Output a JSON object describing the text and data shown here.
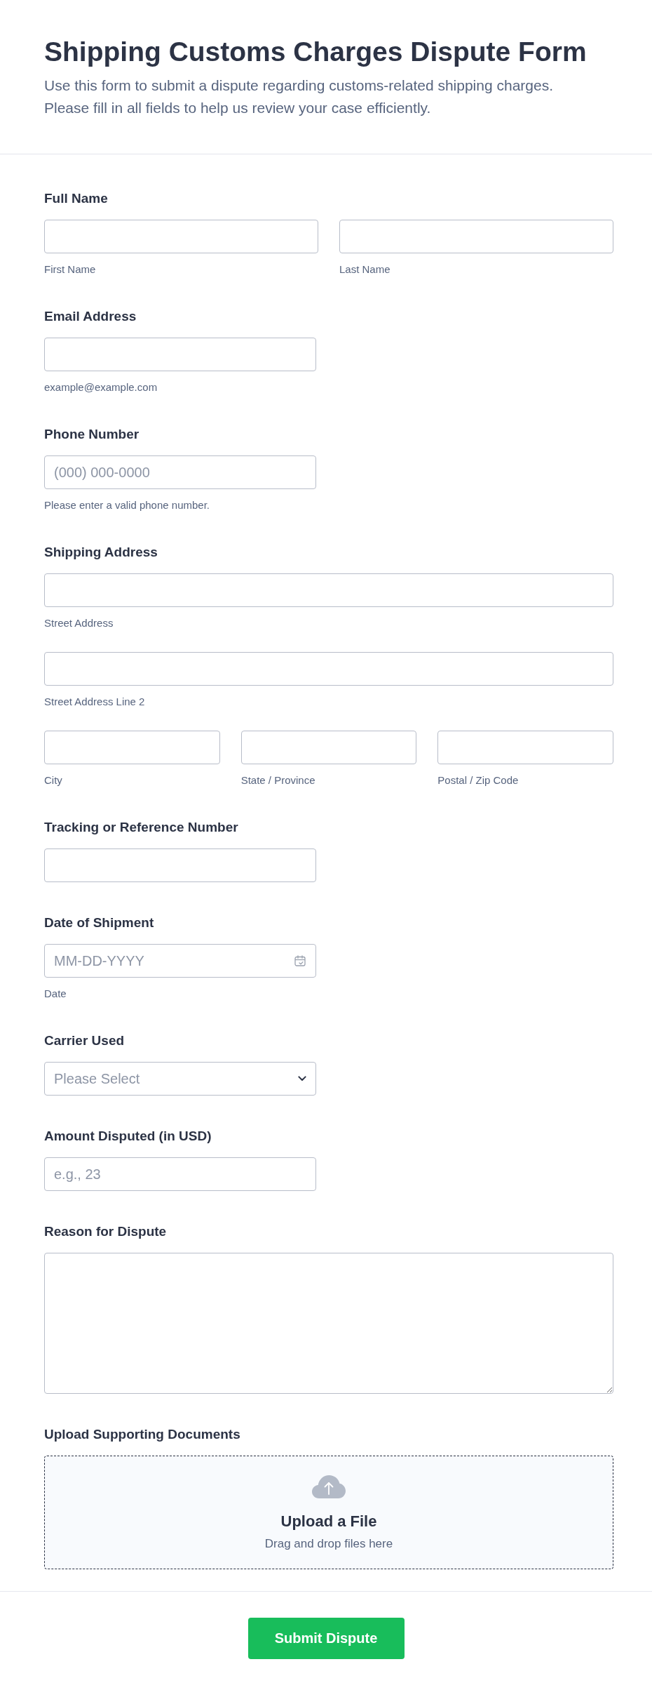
{
  "header": {
    "title": "Shipping Customs Charges Dispute Form",
    "description": [
      "Use this form to submit a dispute regarding customs-related shipping charges.",
      "Please fill in all fields to help us review your case efficiently."
    ]
  },
  "fields": [
    {
      "kind": "multi",
      "label": "Full Name",
      "rows": [
        [
          {
            "sublabel": "First Name"
          },
          {
            "sublabel": "Last Name"
          }
        ]
      ]
    },
    {
      "kind": "text",
      "label": "Email Address",
      "sublabel": "example@example.com"
    },
    {
      "kind": "text",
      "label": "Phone Number",
      "placeholder": "(000) 000-0000",
      "sublabel": "Please enter a valid phone number."
    },
    {
      "kind": "multi",
      "label": "Shipping Address",
      "rows": [
        [
          {
            "sublabel": "Street Address"
          }
        ],
        [
          {
            "sublabel": "Street Address Line 2"
          }
        ],
        [
          {
            "sublabel": "City"
          },
          {
            "sublabel": "State / Province"
          },
          {
            "sublabel": "Postal / Zip Code"
          }
        ]
      ]
    },
    {
      "kind": "text",
      "label": "Tracking or Reference Number"
    },
    {
      "kind": "date",
      "label": "Date of Shipment",
      "placeholder": "MM-DD-YYYY",
      "sublabel": "Date"
    },
    {
      "kind": "select",
      "label": "Carrier Used",
      "placeholder": "Please Select"
    },
    {
      "kind": "text",
      "label": "Amount Disputed (in USD)",
      "placeholder": "e.g., 23"
    },
    {
      "kind": "textarea",
      "label": "Reason for Dispute"
    },
    {
      "kind": "upload",
      "label": "Upload Supporting Documents",
      "title": "Upload a File",
      "hint": "Drag and drop files here"
    }
  ],
  "submit": {
    "label": "Submit Dispute"
  }
}
